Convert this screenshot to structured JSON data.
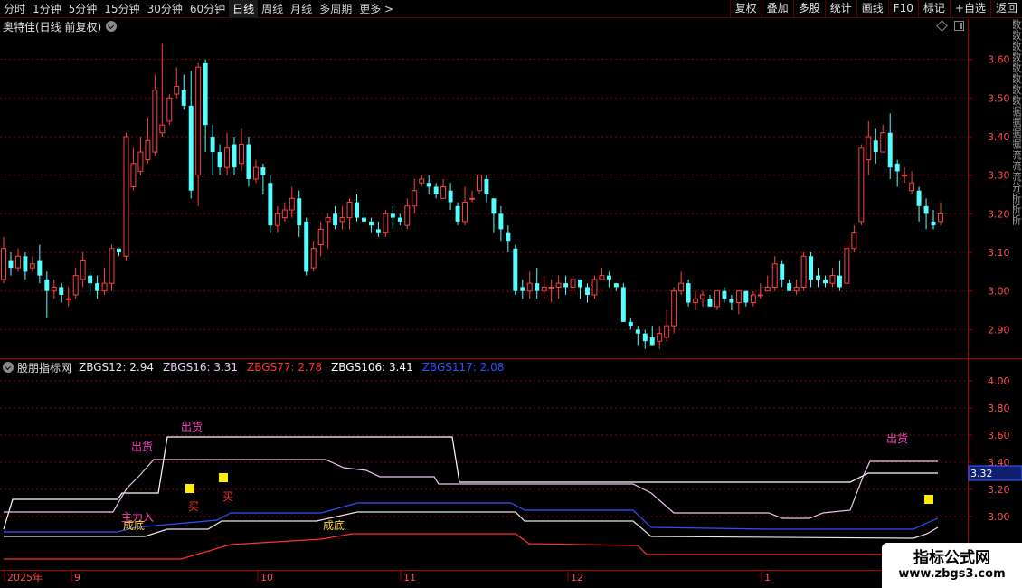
{
  "toolbar": {
    "periods": [
      "分时",
      "1分钟",
      "5分钟",
      "15分钟",
      "30分钟",
      "60分钟",
      "日线",
      "周线",
      "月线",
      "多周期",
      "更多 >"
    ],
    "active_period": "日线",
    "tools": [
      "复权",
      "叠加",
      "多股",
      "统计",
      "画线",
      "F10",
      "标记",
      "+自选",
      "返回"
    ]
  },
  "main_chart": {
    "title": "奥特佳(日线 前复权)",
    "y_ticks": [
      "3.60",
      "3.50",
      "3.40",
      "3.30",
      "3.20",
      "3.10",
      "3.00",
      "2.90"
    ]
  },
  "indicator": {
    "name": "股朋指标网",
    "values": [
      {
        "label": "ZBGS12: 2.94",
        "color": "#e8e8e8"
      },
      {
        "label": "ZBGS16: 3.31",
        "color": "#e8c8f0"
      },
      {
        "label": "ZBGS77: 2.78",
        "color": "#ff3030"
      },
      {
        "label": "ZBGS106: 3.41",
        "color": "#ffffff"
      },
      {
        "label": "ZBGS117: 2.08",
        "color": "#3050ff"
      }
    ],
    "y_ticks": [
      "4.00",
      "3.80",
      "3.60",
      "3.40",
      "3.20",
      "3.00"
    ],
    "current_value": "3.32",
    "annotations": [
      {
        "text": "出货",
        "color": "#ff40c0"
      },
      {
        "text": "出货",
        "color": "#ff40c0"
      },
      {
        "text": "出货",
        "color": "#ff40c0"
      },
      {
        "text": "买",
        "color": "#ff3030"
      },
      {
        "text": "买",
        "color": "#ff3030"
      },
      {
        "text": "主力入",
        "color": "#ff40c0"
      },
      {
        "text": "成底",
        "color": "#ffd040"
      },
      {
        "text": "成底",
        "color": "#ffd040"
      }
    ]
  },
  "x_axis": {
    "labels": [
      "2025年",
      "9",
      "10",
      "11",
      "12",
      "1"
    ]
  },
  "right_strip": "数数数数数数数数据据据据流流流分析析析",
  "watermark": {
    "text": "指标公式网",
    "url": "www.zbgs3.com"
  },
  "colors": {
    "up": "#ff4040",
    "down": "#54ffff",
    "grid": "#8b0000",
    "axis_text": "#ff5050"
  },
  "chart_data": {
    "type": "candlestick",
    "ylim": [
      2.84,
      3.66
    ],
    "candles": [
      [
        3.03,
        3.11,
        3.14,
        3.02
      ],
      [
        3.08,
        3.06,
        3.1,
        3.04
      ],
      [
        3.06,
        3.09,
        3.11,
        3.05
      ],
      [
        3.09,
        3.05,
        3.1,
        3.03
      ],
      [
        3.06,
        3.07,
        3.09,
        3.05
      ],
      [
        3.08,
        3.04,
        3.12,
        3.02
      ],
      [
        3.03,
        3.0,
        3.05,
        2.93
      ],
      [
        3.0,
        3.01,
        3.03,
        2.98
      ],
      [
        3.01,
        2.99,
        3.02,
        2.97
      ],
      [
        2.98,
        2.98,
        3.01,
        2.96
      ],
      [
        2.99,
        3.04,
        3.06,
        2.98
      ],
      [
        3.03,
        3.08,
        3.1,
        3.01
      ],
      [
        3.04,
        3.02,
        3.05,
        2.99
      ],
      [
        3.02,
        3.0,
        3.04,
        2.98
      ],
      [
        3.0,
        3.02,
        3.06,
        2.99
      ],
      [
        3.02,
        3.11,
        3.12,
        3.0
      ],
      [
        3.11,
        3.1,
        3.11,
        3.09
      ],
      [
        3.09,
        3.4,
        3.41,
        3.08
      ],
      [
        3.27,
        3.33,
        3.37,
        3.26
      ],
      [
        3.31,
        3.36,
        3.4,
        3.3
      ],
      [
        3.34,
        3.39,
        3.45,
        3.33
      ],
      [
        3.36,
        3.52,
        3.56,
        3.35
      ],
      [
        3.41,
        3.43,
        3.64,
        3.4
      ],
      [
        3.44,
        3.5,
        3.51,
        3.43
      ],
      [
        3.51,
        3.53,
        3.58,
        3.5
      ],
      [
        3.52,
        3.48,
        3.56,
        3.47
      ],
      [
        3.48,
        3.26,
        3.57,
        3.24
      ],
      [
        3.3,
        3.58,
        3.59,
        3.22
      ],
      [
        3.59,
        3.43,
        3.6,
        3.36
      ],
      [
        3.4,
        3.36,
        3.43,
        3.3
      ],
      [
        3.36,
        3.32,
        3.38,
        3.3
      ],
      [
        3.32,
        3.37,
        3.41,
        3.3
      ],
      [
        3.38,
        3.32,
        3.4,
        3.3
      ],
      [
        3.33,
        3.38,
        3.42,
        3.31
      ],
      [
        3.38,
        3.29,
        3.4,
        3.27
      ],
      [
        3.29,
        3.32,
        3.34,
        3.28
      ],
      [
        3.32,
        3.3,
        3.33,
        3.25
      ],
      [
        3.28,
        3.17,
        3.3,
        3.15
      ],
      [
        3.17,
        3.2,
        3.22,
        3.15
      ],
      [
        3.19,
        3.21,
        3.23,
        3.18
      ],
      [
        3.21,
        3.24,
        3.27,
        3.19
      ],
      [
        3.24,
        3.17,
        3.26,
        3.14
      ],
      [
        3.18,
        3.05,
        3.19,
        3.04
      ],
      [
        3.06,
        3.11,
        3.13,
        3.05
      ],
      [
        3.12,
        3.16,
        3.18,
        3.09
      ],
      [
        3.18,
        3.19,
        3.2,
        3.11
      ],
      [
        3.2,
        3.17,
        3.22,
        3.16
      ],
      [
        3.18,
        3.19,
        3.22,
        3.16
      ],
      [
        3.19,
        3.23,
        3.24,
        3.16
      ],
      [
        3.23,
        3.19,
        3.25,
        3.18
      ],
      [
        3.19,
        3.18,
        3.21,
        3.18
      ],
      [
        3.18,
        3.17,
        3.19,
        3.15
      ],
      [
        3.16,
        3.15,
        3.18,
        3.14
      ],
      [
        3.15,
        3.2,
        3.21,
        3.14
      ],
      [
        3.2,
        3.19,
        3.22,
        3.16
      ],
      [
        3.19,
        3.18,
        3.2,
        3.17
      ],
      [
        3.17,
        3.22,
        3.24,
        3.16
      ],
      [
        3.22,
        3.26,
        3.29,
        3.2
      ],
      [
        3.28,
        3.29,
        3.3,
        3.27
      ],
      [
        3.28,
        3.27,
        3.3,
        3.25
      ],
      [
        3.27,
        3.25,
        3.28,
        3.24
      ],
      [
        3.24,
        3.27,
        3.29,
        3.24
      ],
      [
        3.26,
        3.23,
        3.28,
        3.21
      ],
      [
        3.22,
        3.18,
        3.23,
        3.17
      ],
      [
        3.18,
        3.23,
        3.27,
        3.17
      ],
      [
        3.24,
        3.24,
        3.26,
        3.23
      ],
      [
        3.26,
        3.3,
        3.3,
        3.25
      ],
      [
        3.29,
        3.25,
        3.3,
        3.23
      ],
      [
        3.24,
        3.2,
        3.24,
        3.15
      ],
      [
        3.2,
        3.16,
        3.22,
        3.13
      ],
      [
        3.15,
        3.13,
        3.17,
        3.1
      ],
      [
        3.11,
        3.0,
        3.12,
        2.99
      ],
      [
        3.01,
        3.0,
        3.03,
        2.98
      ],
      [
        3.0,
        3.02,
        3.05,
        2.98
      ],
      [
        3.02,
        3.0,
        3.06,
        2.98
      ],
      [
        3.0,
        3.01,
        3.04,
        2.98
      ],
      [
        3.01,
        3.01,
        3.03,
        2.97
      ],
      [
        3.01,
        3.02,
        3.04,
        2.98
      ],
      [
        3.02,
        3.01,
        3.04,
        2.99
      ],
      [
        3.01,
        3.03,
        3.04,
        2.99
      ],
      [
        3.03,
        3.01,
        3.03,
        2.98
      ],
      [
        3.01,
        2.99,
        3.02,
        2.97
      ],
      [
        2.99,
        3.03,
        3.04,
        2.98
      ],
      [
        3.03,
        3.04,
        3.06,
        3.03
      ],
      [
        3.04,
        3.03,
        3.05,
        3.01
      ],
      [
        3.02,
        3.01,
        3.02,
        3.0
      ],
      [
        3.01,
        2.92,
        3.02,
        2.92
      ],
      [
        2.92,
        2.91,
        2.93,
        2.9
      ],
      [
        2.9,
        2.89,
        2.91,
        2.86
      ],
      [
        2.89,
        2.87,
        2.9,
        2.85
      ],
      [
        2.88,
        2.86,
        2.91,
        2.86
      ],
      [
        2.87,
        2.89,
        2.91,
        2.85
      ],
      [
        2.88,
        2.91,
        2.95,
        2.87
      ],
      [
        2.91,
        3.0,
        3.01,
        2.89
      ],
      [
        3.0,
        3.02,
        3.05,
        2.99
      ],
      [
        3.02,
        2.97,
        3.03,
        2.96
      ],
      [
        2.97,
        2.98,
        3.0,
        2.95
      ],
      [
        2.98,
        2.99,
        3.0,
        2.96
      ],
      [
        2.98,
        2.96,
        2.99,
        2.96
      ],
      [
        2.96,
        3.0,
        3.0,
        2.95
      ],
      [
        3.0,
        2.98,
        3.01,
        2.97
      ],
      [
        2.98,
        2.97,
        2.99,
        2.95
      ],
      [
        2.97,
        3.0,
        3.0,
        2.94
      ],
      [
        3.0,
        2.97,
        3.0,
        2.96
      ],
      [
        2.97,
        2.99,
        3.0,
        2.96
      ],
      [
        2.99,
        2.99,
        3.02,
        2.98
      ],
      [
        3.0,
        3.01,
        3.04,
        3.0
      ],
      [
        3.01,
        3.07,
        3.09,
        3.0
      ],
      [
        3.07,
        3.03,
        3.08,
        3.01
      ],
      [
        3.02,
        3.0,
        3.03,
        3.0
      ],
      [
        3.0,
        3.01,
        3.03,
        2.99
      ],
      [
        3.01,
        3.09,
        3.1,
        3.0
      ],
      [
        3.09,
        3.03,
        3.1,
        3.01
      ],
      [
        3.04,
        3.03,
        3.06,
        3.01
      ],
      [
        3.03,
        3.02,
        3.04,
        3.01
      ],
      [
        3.02,
        3.04,
        3.06,
        3.01
      ],
      [
        3.04,
        3.01,
        3.08,
        3.0
      ],
      [
        3.02,
        3.11,
        3.13,
        3.01
      ],
      [
        3.11,
        3.15,
        3.17,
        3.1
      ],
      [
        3.18,
        3.37,
        3.38,
        3.17
      ],
      [
        3.34,
        3.4,
        3.44,
        3.3
      ],
      [
        3.39,
        3.36,
        3.42,
        3.33
      ],
      [
        3.36,
        3.41,
        3.43,
        3.36
      ],
      [
        3.41,
        3.32,
        3.46,
        3.29
      ],
      [
        3.33,
        3.31,
        3.34,
        3.27
      ],
      [
        3.3,
        3.3,
        3.32,
        3.28
      ],
      [
        3.26,
        3.28,
        3.31,
        3.25
      ],
      [
        3.26,
        3.22,
        3.27,
        3.18
      ],
      [
        3.22,
        3.2,
        3.24,
        3.16
      ],
      [
        3.18,
        3.17,
        3.21,
        3.16
      ],
      [
        3.18,
        3.2,
        3.23,
        3.17
      ]
    ]
  }
}
